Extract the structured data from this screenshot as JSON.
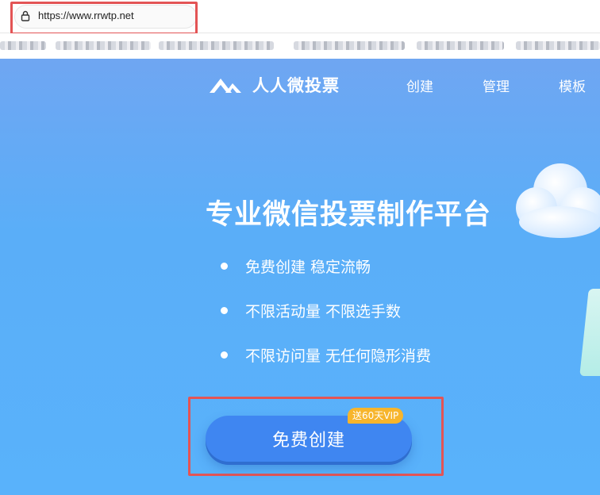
{
  "browser": {
    "url": "https://www.rrwtp.net",
    "lock_icon": "lock-icon"
  },
  "header": {
    "logo_text": "人人微投票",
    "logo_icon": "mountain-logo-icon",
    "nav": [
      "创建",
      "管理",
      "模板"
    ]
  },
  "hero": {
    "title": "专业微信投票制作平台",
    "features": [
      "免费创建 稳定流畅",
      "不限活动量 不限选手数",
      "不限访问量 无任何隐形消费"
    ],
    "cta_label": "免费创建",
    "badge": "送60天VIP"
  },
  "colors": {
    "hero_top": "#6fa6f2",
    "hero_bottom": "#59b2fb",
    "cta": "#3f86f1",
    "badge": "#f7b52c",
    "highlight": "#e35455"
  }
}
